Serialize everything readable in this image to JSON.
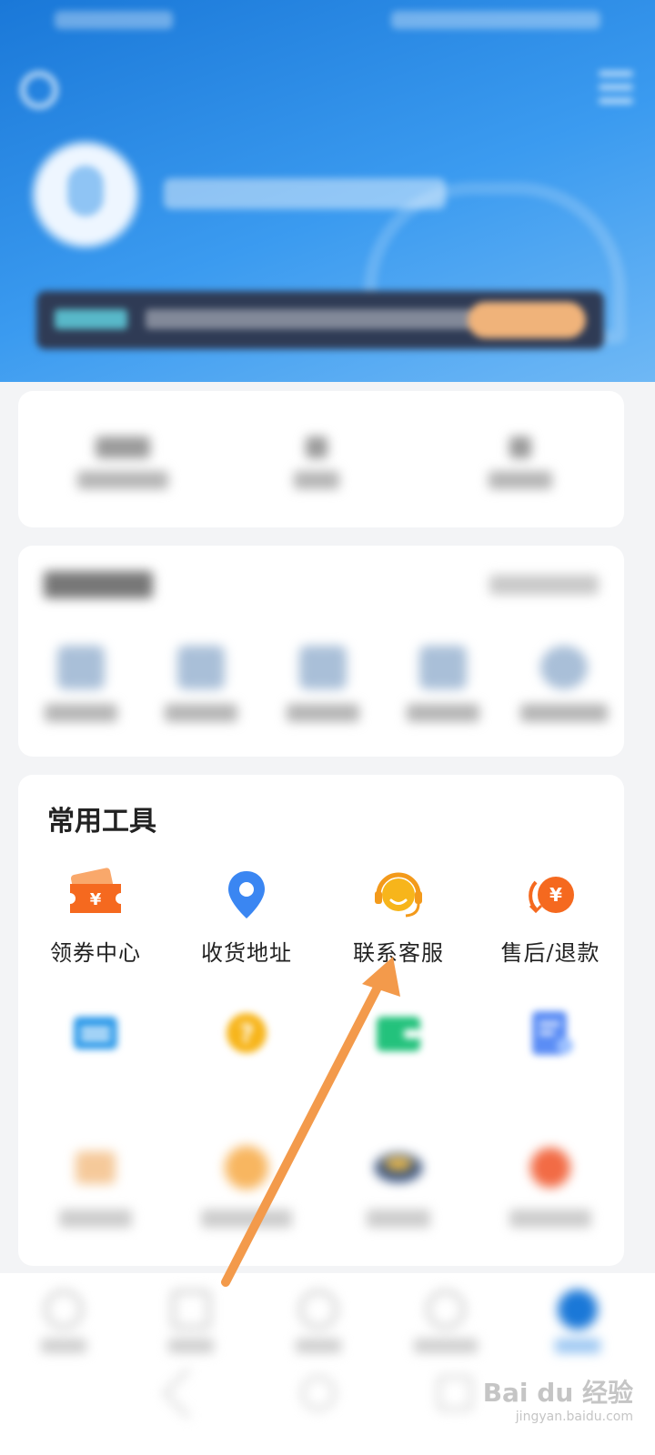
{
  "tools": {
    "title": "常用工具",
    "items": [
      {
        "label": "领券中心",
        "icon": "coupon-icon"
      },
      {
        "label": "收货地址",
        "icon": "location-pin-icon"
      },
      {
        "label": "联系客服",
        "icon": "headset-icon"
      },
      {
        "label": "售后/退款",
        "icon": "refund-icon"
      }
    ]
  },
  "watermark": {
    "brand": "Bai du 经验",
    "domain": "jingyan.baidu.com"
  },
  "colors": {
    "header_blue": "#1a78d8",
    "arrow_orange": "#f39a4b",
    "coupon_orange": "#f5691f",
    "pin_blue": "#3a86f2",
    "headset_yellow": "#f7b51b"
  }
}
